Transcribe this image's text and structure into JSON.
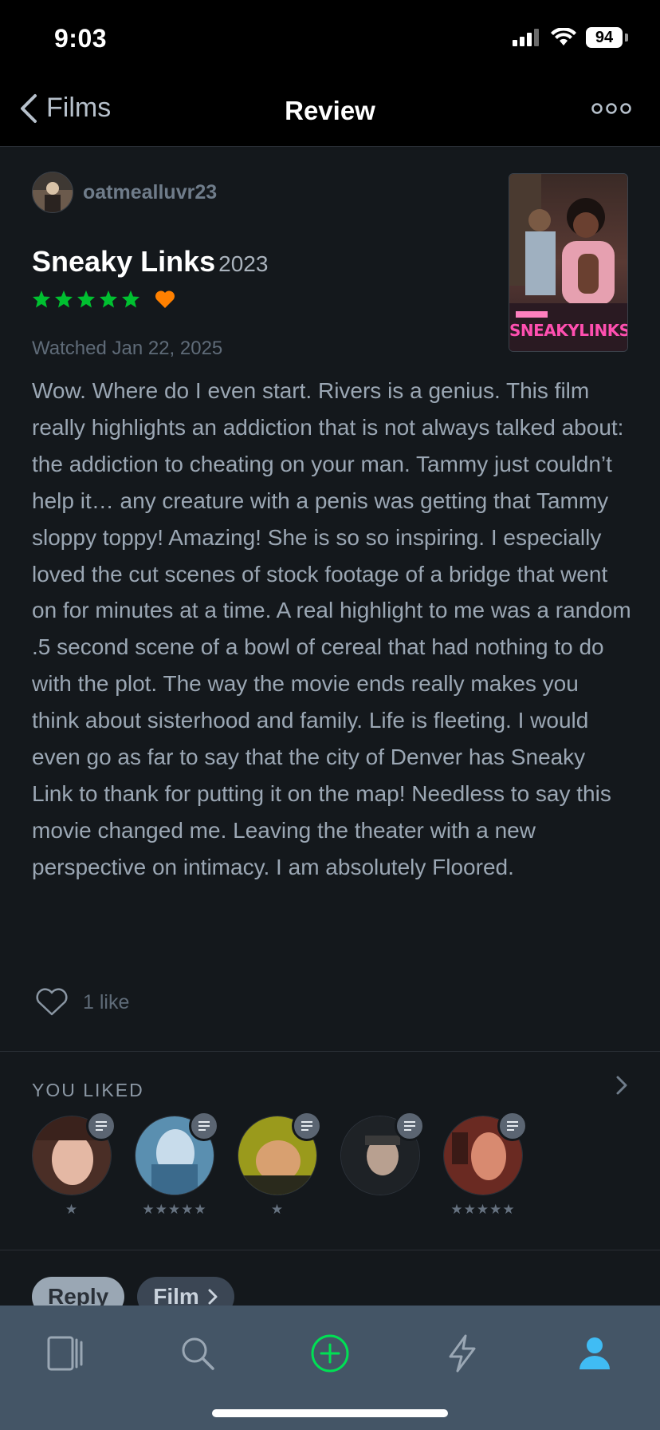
{
  "status_bar": {
    "time": "9:03",
    "battery": "94"
  },
  "nav": {
    "back_label": "Films",
    "title": "Review"
  },
  "review": {
    "username": "oatmealluvr23",
    "film_title": "Sneaky Links",
    "film_year": "2023",
    "rating_stars": 5,
    "liked": true,
    "poster_title": "SNEAKYLINKS",
    "watched": "Watched Jan 22, 2025",
    "body": "Wow. Where do I even start. Rivers is a genius. This film really highlights an addiction that is not always talked about: the addiction to cheating on your man. Tammy just couldn’t help it… any creature with a penis was getting that Tammy sloppy toppy! Amazing! She is so so inspiring. I especially loved the cut scenes of stock footage of a bridge that went on for minutes at a time. A real highlight to me was a random .5 second scene of a bowl of cereal that had nothing to do with the plot. The way the movie ends really makes you think about sisterhood and family. Life is fleeting. I would even go as far to say that the city of Denver has Sneaky Link to thank for putting it on the map! Needless to say this movie changed me. Leaving the theater with a new perspective on intimacy. I am absolutely Floored.",
    "likes_label": "1 like"
  },
  "you_liked": {
    "heading": "YOU LIKED",
    "items": [
      {
        "stars": "★"
      },
      {
        "stars": "★★★★★"
      },
      {
        "stars": "★"
      },
      {
        "stars": ""
      },
      {
        "stars": "★★★★★"
      }
    ]
  },
  "actions": {
    "reply": "Reply",
    "film": "Film"
  },
  "colors": {
    "star_green": "#00c030",
    "heart_orange": "#ff8000",
    "tab_active": "#40bcf4",
    "add_green": "#00e054"
  },
  "tabs": [
    "films-tab",
    "search-tab",
    "add-tab",
    "activity-tab",
    "profile-tab"
  ]
}
